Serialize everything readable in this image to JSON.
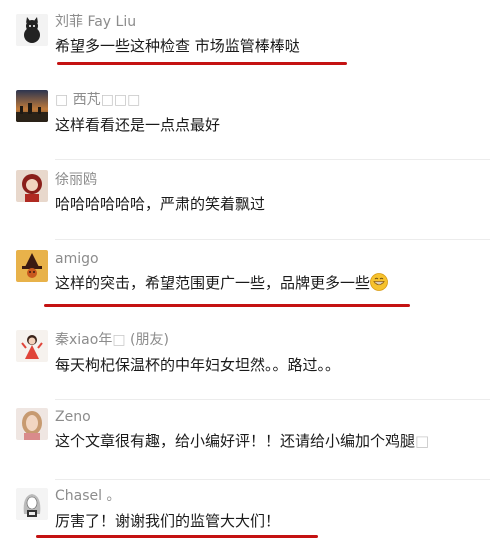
{
  "comments": [
    {
      "name": "刘菲 Fay Liu",
      "text": "希望多一些这种检查 市场监管棒棒哒",
      "avatar_icon": "cat-avatar"
    },
    {
      "name": "西芃",
      "name_prefix": "□",
      "name_suffix": "□□□",
      "text": "这样看看还是一点点最好",
      "avatar_icon": "sunset-city-avatar"
    },
    {
      "name": "徐丽鸥",
      "text": "哈哈哈哈哈哈，严肃的笑着飘过",
      "avatar_icon": "girl-red-avatar"
    },
    {
      "name": "amigo",
      "text": "这样的突击，希望范围更广一些，品牌更多一些",
      "emoji_icon": "grin-emoji",
      "avatar_icon": "witch-avatar"
    },
    {
      "name": "秦xiao年",
      "name_box": "□",
      "name_suffix": "(朋友)",
      "text": "每天枸杞保温杯的中年妇女坦然。。路过。。",
      "avatar_icon": "cartoon-girl-avatar"
    },
    {
      "name": "Zeno",
      "text": "这个文章很有趣，给小编好评！！还请给小编加个鸡腿",
      "text_box": "□",
      "avatar_icon": "woman-portrait-avatar"
    },
    {
      "name": "Chasel 。",
      "text": "厉害了！谢谢我们的监管大大们！",
      "avatar_icon": "sketch-girl-avatar"
    }
  ],
  "colors": {
    "underline": "#c41212",
    "name": "#8c8c8c",
    "text": "#1a1a1a"
  }
}
